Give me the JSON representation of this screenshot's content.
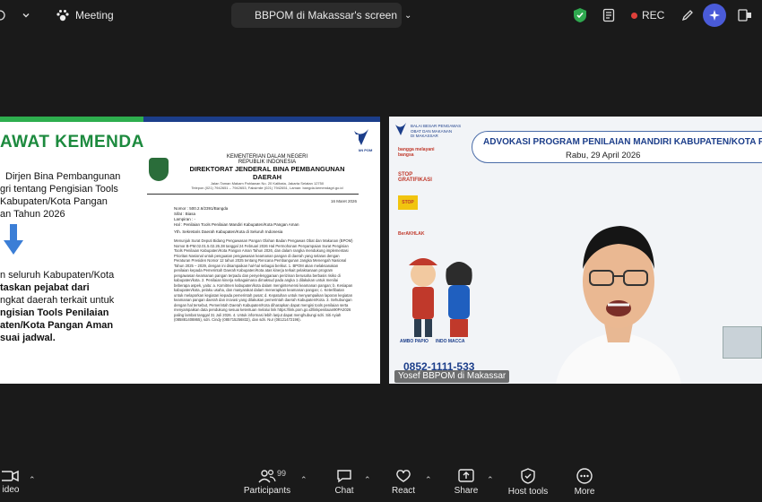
{
  "topbar": {
    "meeting_label": "Meeting",
    "share_label": "BBPOM di Makassar's screen",
    "rec_label": "REC"
  },
  "share": {
    "title": "AWAT KEMENDAGRI",
    "left_lines": [
      "Dirjen Bina Pembangunan",
      "gri tentang Pengisian Tools",
      "Kabupaten/Kota Pangan",
      "an Tahun 2026"
    ],
    "left_lines2": [
      "n seluruh Kabupaten/Kota",
      "taskan pejabat dari",
      "ngkat daerah terkait untuk",
      "ngisian Tools Penilaian",
      "aten/Kota Pangan Aman",
      "suai jadwal."
    ],
    "badan_label": "BADAN POM",
    "doc": {
      "h1": "KEMENTERIAN DALAM NEGERI",
      "h2": "REPUBLIK INDONESIA",
      "h3": "DIREKTORAT JENDERAL BINA PEMBANGUNAN DAERAH",
      "h4": "Jalan Taman Makam Pahlawan No. 20 Kalibata, Jakarta Selatan 12750",
      "h5": "Telepon (021) 7942651 – 7942653, Faksimile (021) 7942651, Laman: bangda.kemendagri.go.id",
      "date": "16 Maret 2026",
      "meta": [
        "Nomor : 500.2.6/2391/Bangda",
        "Sifat : Biasa",
        "Lampiran : -",
        "Hal : Penilaian Tools Penilaian Mandiri Kabupaten/Kota Pangan Aman"
      ],
      "to": "Yth. Sekretaris Daerah Kabupaten/Kota di Seluruh Indonesia",
      "body": "Menunjuk Surat Deputi Bidang Pengawasan Pangan Olahan Badan Pengawas Obat dan Makanan (BPOM) Nomor B-PM.02.01.5.02.26.38 tanggal 24 Februari 2026 Hal Permohonan Penyampaian Surat Pengisian Tools Penilaian Kabupaten/Kota Pangan Aman Tahun 2026, dan dalam rangka mendukung implementasi Prioritas Nasional untuk penguatan pengawasan keamanan pangan di daerah yang selaras dengan Peraturan Presiden Nomor 12 tahun 2025 tentang Rencana Pembangunan Jangka Menengah Nasional Tahun 2025 – 2029, dengan ini disampaikan hal-hal sebagai berikut. 1. BPOM akan melaksanakan penilaian kepada Pemerintah Daerah Kabupaten/Kota atas kinerja terkait pelaksanaan program pengawasan keamanan pangan terpadu dan penyelenggaraan perizinan berusaha berbasis risiko di kabupaten/kota. 2. Penilaian kinerja sebagaimana dimaksud pada angka 1 dilakukan untuk menilai beberapa aspek, yaitu: a. Komitmen kabupaten/kota dalam mengintervensi keamanan pangan; b. Kesiapan kabupaten/kota, pelaku usaha, dan masyarakat dalam menerapkan keamanan pangan; c. Keterlibatan untuk melaporkan kegiatan kepada pemerintah pusat; d. Kepatuhan untuk menyampaikan laporan kegiatan keamanan pangan daerah dan inovasi yang dilakukan pemerintah daerah Kabupaten/Kota. 3. Sehubungan dengan hal tersebut, Pemerintah Daerah Kabupaten/Kota diharapkan dapat mengisi tools penilaian serta menyampaikan data pendukung sesuai ketentuan melalui link https://link.pom.go.id/linkpenilaian90PA2026 paling lambat tanggal 31 Juli 2026. 4. Untuk informasi lebih lanjut dapat menghubungi sdri. Siti Ayiah (085881408865), sdri. Cindy (085715256832), dan sdri. Nur (08121472196)."
    }
  },
  "video": {
    "banner_title": "ADVOKASI PROGRAM PENILAIAN MANDIRI KABUPATEN/KOTA PANGAN AM",
    "banner_date": "Rabu, 29 April 2026",
    "logo_text": [
      "BALAI BESAR PENGAWAS",
      "OBAT DAN MAKANAN",
      "DI MAKASSAR"
    ],
    "side_labels": [
      "bangga melayani bangsa",
      "STOP GRATIFIKASI",
      "STOP",
      "BerAKHLAK"
    ],
    "mascot_labels": [
      "AMBO PAPIO",
      "INDO MACCA"
    ],
    "phone": "0852-1111-533",
    "name_tag": "Yosef BBPOM di Makassar"
  },
  "bottombar": {
    "video_label": "ideo",
    "participants_label": "Participants",
    "participants_count": "99",
    "chat_label": "Chat",
    "react_label": "React",
    "share_label": "Share",
    "host_tools_label": "Host tools",
    "more_label": "More"
  },
  "colors": {
    "rec_dot": "#e0403a",
    "ai_button": "#4a5bd8",
    "shield_green": "#2fa84f",
    "kemendagri_green": "#1c8a3e",
    "bpom_blue": "#1c3e8a"
  }
}
